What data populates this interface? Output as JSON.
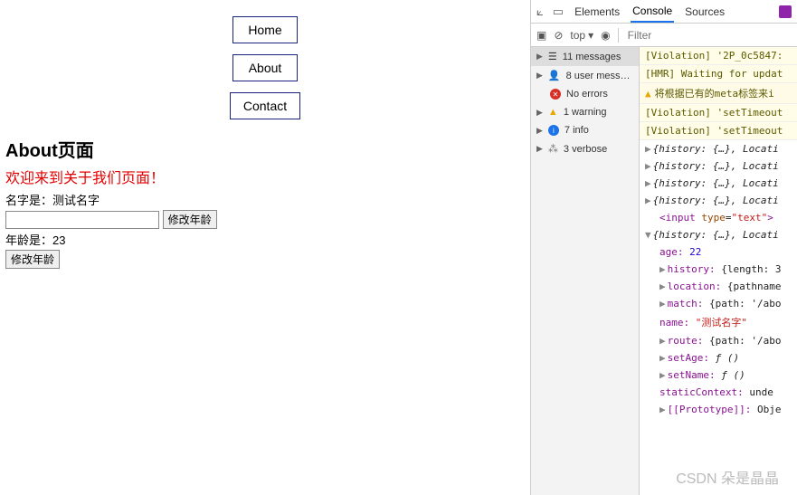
{
  "nav": {
    "home": "Home",
    "about": "About",
    "contact": "Contact"
  },
  "content": {
    "heading": "About页面",
    "welcome": "欢迎来到关于我们页面！",
    "name_label": "名字是：测试名字",
    "edit_btn1": "修改年龄",
    "age_label": "年龄是：23",
    "edit_btn2": "修改年龄"
  },
  "devtools": {
    "tabs": {
      "elements": "Elements",
      "console": "Console",
      "sources": "Sources"
    },
    "toolbar": {
      "top": "top",
      "filter_placeholder": "Filter"
    },
    "side": {
      "messages": "11 messages",
      "user": "8 user mess…",
      "errors": "No errors",
      "warning": "1 warning",
      "info": "7 info",
      "verbose": "3 verbose"
    },
    "logs": {
      "v1": "[Violation] '2P_0c5847:",
      "v2": "[HMR] Waiting for updat",
      "w1": "将根据已有的meta标签来i",
      "v3": "[Violation] 'setTimeout",
      "v4": "[Violation] 'setTimeout",
      "hist": "{history: {…}, Locati",
      "input_tag": "<input type=\"text\">",
      "age_k": "age:",
      "age_v": "22",
      "history_k": "history:",
      "history_v": "{length: 3",
      "location_k": "location:",
      "location_v": "{pathname",
      "match_k": "match:",
      "match_v": "{path: '/abo",
      "name_k": "name:",
      "name_v": "\"测试名字\"",
      "route_k": "route:",
      "route_v": "{path: '/abo",
      "setAge_k": "setAge:",
      "setAge_v": "ƒ ()",
      "setName_k": "setName:",
      "setName_v": "ƒ ()",
      "static_k": "staticContext:",
      "static_v": "unde",
      "proto_k": "[[Prototype]]:",
      "proto_v": "Obje"
    }
  },
  "watermark": "CSDN 朵是晶晶"
}
